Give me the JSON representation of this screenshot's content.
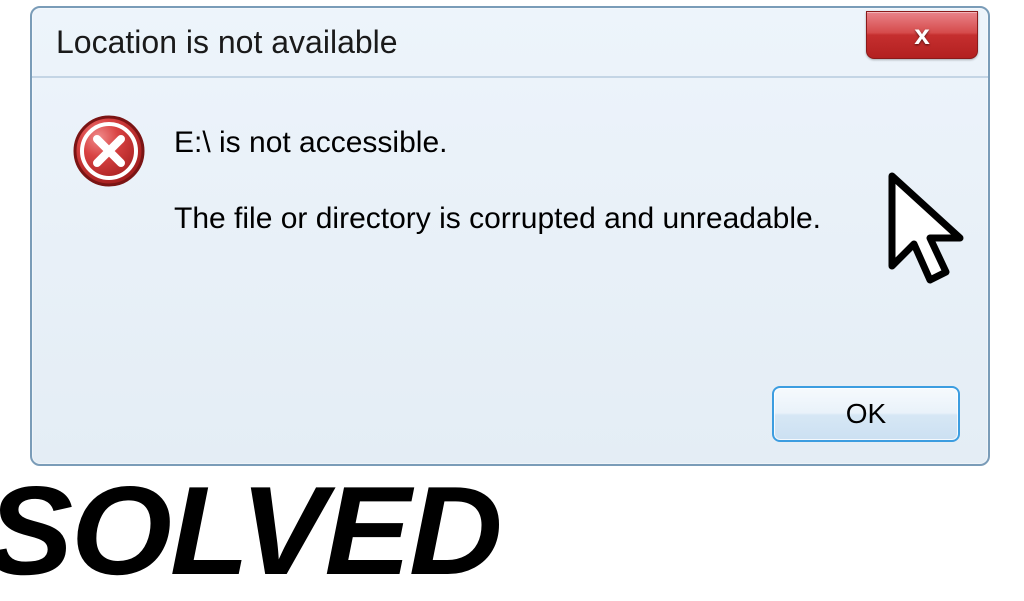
{
  "dialog": {
    "title": "Location is not available",
    "close_label": "x",
    "message_line1": "E:\\ is not accessible.",
    "message_line2": "The file or directory is corrupted and unreadable.",
    "ok_label": "OK"
  },
  "overlay": {
    "solved_text": "SOLVED"
  },
  "colors": {
    "close_red": "#c52f2f",
    "ok_border": "#3c9de0",
    "dialog_border": "#7a9cb8",
    "error_icon": "#c9302c"
  }
}
